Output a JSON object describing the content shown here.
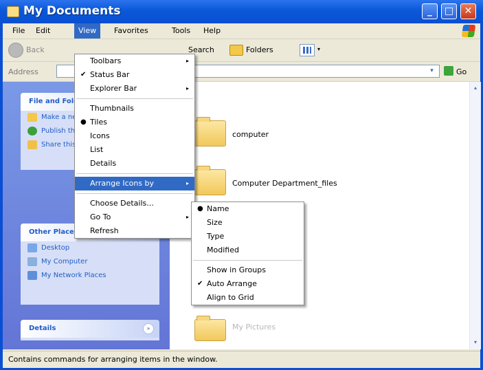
{
  "window": {
    "title": "My Documents",
    "controls": {
      "minimize": "_",
      "maximize": "□",
      "close": "✕"
    }
  },
  "menubar": {
    "items": [
      "File",
      "Edit",
      "View",
      "Favorites",
      "Tools",
      "Help"
    ],
    "active": "View"
  },
  "toolbar": {
    "back_label": "Back",
    "search_label": "Search",
    "folders_label": "Folders",
    "views_arrow": "▾"
  },
  "addressbar": {
    "label": "Address",
    "value": "",
    "go_label": "Go",
    "dropdown_glyph": "▾"
  },
  "left_pane": {
    "file_tasks": {
      "title": "File and Folder Tasks",
      "items": [
        "Make a new folder",
        "Publish this folder to the Web",
        "Share this folder"
      ]
    },
    "other_places": {
      "title": "Other Places",
      "items": [
        "Desktop",
        "My Computer",
        "My Network Places"
      ]
    },
    "details": {
      "title": "Details",
      "collapse_glyph": "»"
    }
  },
  "content": {
    "items": [
      "computer",
      "Computer Department_files",
      "My Pictures"
    ]
  },
  "view_menu": {
    "items": [
      {
        "label": "Toolbars",
        "mark": "",
        "arrow": "▸"
      },
      {
        "label": "Status Bar",
        "mark": "✔",
        "arrow": ""
      },
      {
        "label": "Explorer Bar",
        "mark": "",
        "arrow": "▸"
      },
      {
        "label": "Thumbnails",
        "mark": "",
        "arrow": ""
      },
      {
        "label": "Tiles",
        "mark": "●",
        "arrow": ""
      },
      {
        "label": "Icons",
        "mark": "",
        "arrow": ""
      },
      {
        "label": "List",
        "mark": "",
        "arrow": ""
      },
      {
        "label": "Details",
        "mark": "",
        "arrow": ""
      },
      {
        "label": "Arrange Icons by",
        "mark": "",
        "arrow": "▸"
      },
      {
        "label": "Choose Details...",
        "mark": "",
        "arrow": ""
      },
      {
        "label": "Go To",
        "mark": "",
        "arrow": "▸"
      },
      {
        "label": "Refresh",
        "mark": "",
        "arrow": ""
      }
    ],
    "highlighted": "Arrange Icons by"
  },
  "arrange_menu": {
    "items": [
      {
        "label": "Name",
        "mark": "●"
      },
      {
        "label": "Size",
        "mark": ""
      },
      {
        "label": "Type",
        "mark": ""
      },
      {
        "label": "Modified",
        "mark": ""
      },
      {
        "label": "Show in Groups",
        "mark": ""
      },
      {
        "label": "Auto Arrange",
        "mark": "✔"
      },
      {
        "label": "Align to Grid",
        "mark": ""
      }
    ]
  },
  "statusbar": {
    "text": "Contains commands for arranging items in the window."
  },
  "colors": {
    "title_blue": "#0a4fd3",
    "menu_highlight": "#316ac5",
    "task_pane": "#6375d6",
    "link_blue": "#215dc6"
  }
}
